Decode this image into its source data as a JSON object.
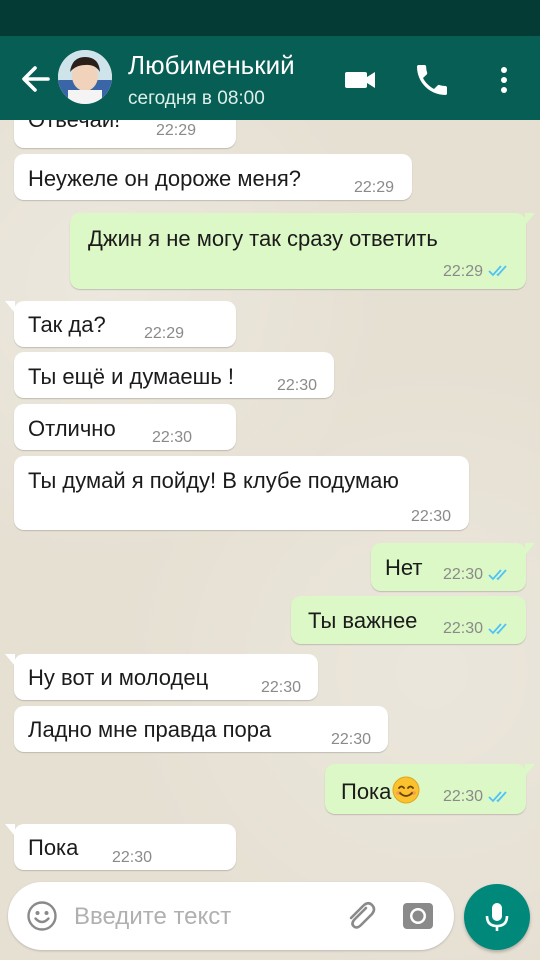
{
  "header": {
    "contact_name": "Любименький",
    "status": "сегодня в 08:00"
  },
  "icons": {
    "back": "arrow-left-icon",
    "video": "video-camera-icon",
    "call": "phone-icon",
    "menu": "more-vertical-icon",
    "emoji": "smiley-icon",
    "attach": "paperclip-icon",
    "camera": "camera-icon",
    "mic": "microphone-icon"
  },
  "colors": {
    "appbar": "#075e54",
    "statusbar": "#053b35",
    "incoming_bubble": "#ffffff",
    "outgoing_bubble": "#dcf8c6",
    "read_ticks": "#4fc3f7",
    "mic_button": "#00897b"
  },
  "messages": [
    {
      "dir": "in",
      "text": "Отвечай!",
      "time": "22:29"
    },
    {
      "dir": "in",
      "text": "Неужеле он дороже меня?",
      "time": "22:29"
    },
    {
      "dir": "out",
      "text": "Джин я не могу так сразу ответить",
      "time": "22:29",
      "read": true
    },
    {
      "dir": "in",
      "text": "Так да?",
      "time": "22:29"
    },
    {
      "dir": "in",
      "text": "Ты ещё и думаешь !",
      "time": "22:30"
    },
    {
      "dir": "in",
      "text": "Отлично",
      "time": "22:30"
    },
    {
      "dir": "in",
      "text": "Ты думай я пойду! В клубе подумаю",
      "time": "22:30"
    },
    {
      "dir": "out",
      "text": "Нет",
      "time": "22:30",
      "read": true
    },
    {
      "dir": "out",
      "text": "Ты важнее",
      "time": "22:30",
      "read": true
    },
    {
      "dir": "in",
      "text": "Ну вот и молодец",
      "time": "22:30"
    },
    {
      "dir": "in",
      "text": "Ладно мне правда пора",
      "time": "22:30"
    },
    {
      "dir": "out",
      "text": "Пока",
      "emoji": "smiling-face-emoji",
      "time": "22:30",
      "read": true
    },
    {
      "dir": "in",
      "text": "Пока",
      "time": "22:30"
    }
  ],
  "input": {
    "placeholder": "Введите текст"
  }
}
